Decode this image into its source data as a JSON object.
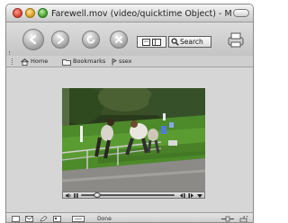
{
  "window": {
    "title": "Farewell.mov (video/quicktime Object) - Mozilla"
  },
  "toolbar": {
    "search_label": "Search"
  },
  "bookmarks": [
    {
      "label": "Home",
      "icon": "home-icon"
    },
    {
      "label": "Bookmarks",
      "icon": "bookmarks-folder-icon"
    },
    {
      "label": "ssex",
      "icon": "bookmark-link-icon"
    }
  ],
  "player": {
    "playback_position": 0.17,
    "volume": 0.8
  },
  "status": {
    "text": "Done"
  },
  "colors": {
    "window_chrome": "#d9d9d9",
    "toolbar": "#c4c4c4",
    "video_background": "#1d2a14",
    "close_button": "#d6402e",
    "minimize_button": "#d59b16",
    "zoom_button": "#3e9c2a"
  }
}
